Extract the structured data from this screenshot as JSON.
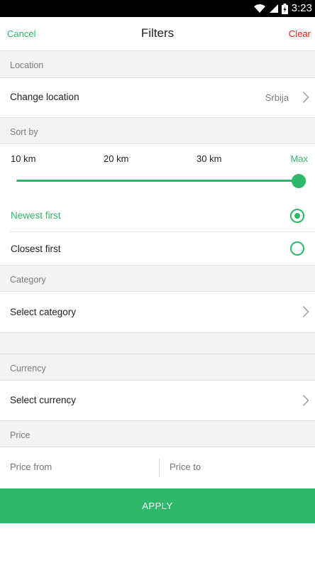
{
  "status_bar": {
    "time": "3:23"
  },
  "header": {
    "cancel": "Cancel",
    "title": "Filters",
    "clear": "Clear"
  },
  "location": {
    "section": "Location",
    "label": "Change location",
    "value": "Srbija"
  },
  "sort": {
    "section": "Sort by",
    "distance_labels": [
      "10 km",
      "20 km",
      "30 km",
      "Max"
    ],
    "distance_selected": "Max",
    "options": [
      {
        "label": "Newest first",
        "selected": true
      },
      {
        "label": "Closest first",
        "selected": false
      }
    ]
  },
  "category": {
    "section": "Category",
    "label": "Select category"
  },
  "currency": {
    "section": "Currency",
    "label": "Select currency"
  },
  "price": {
    "section": "Price",
    "from_placeholder": "Price from",
    "to_placeholder": "Price to"
  },
  "apply_label": "APPLY",
  "colors": {
    "accent": "#2db86a",
    "danger": "#e8221c"
  },
  "icons": [
    "wifi-icon",
    "signal-icon",
    "battery-icon",
    "chevron-right-icon"
  ]
}
